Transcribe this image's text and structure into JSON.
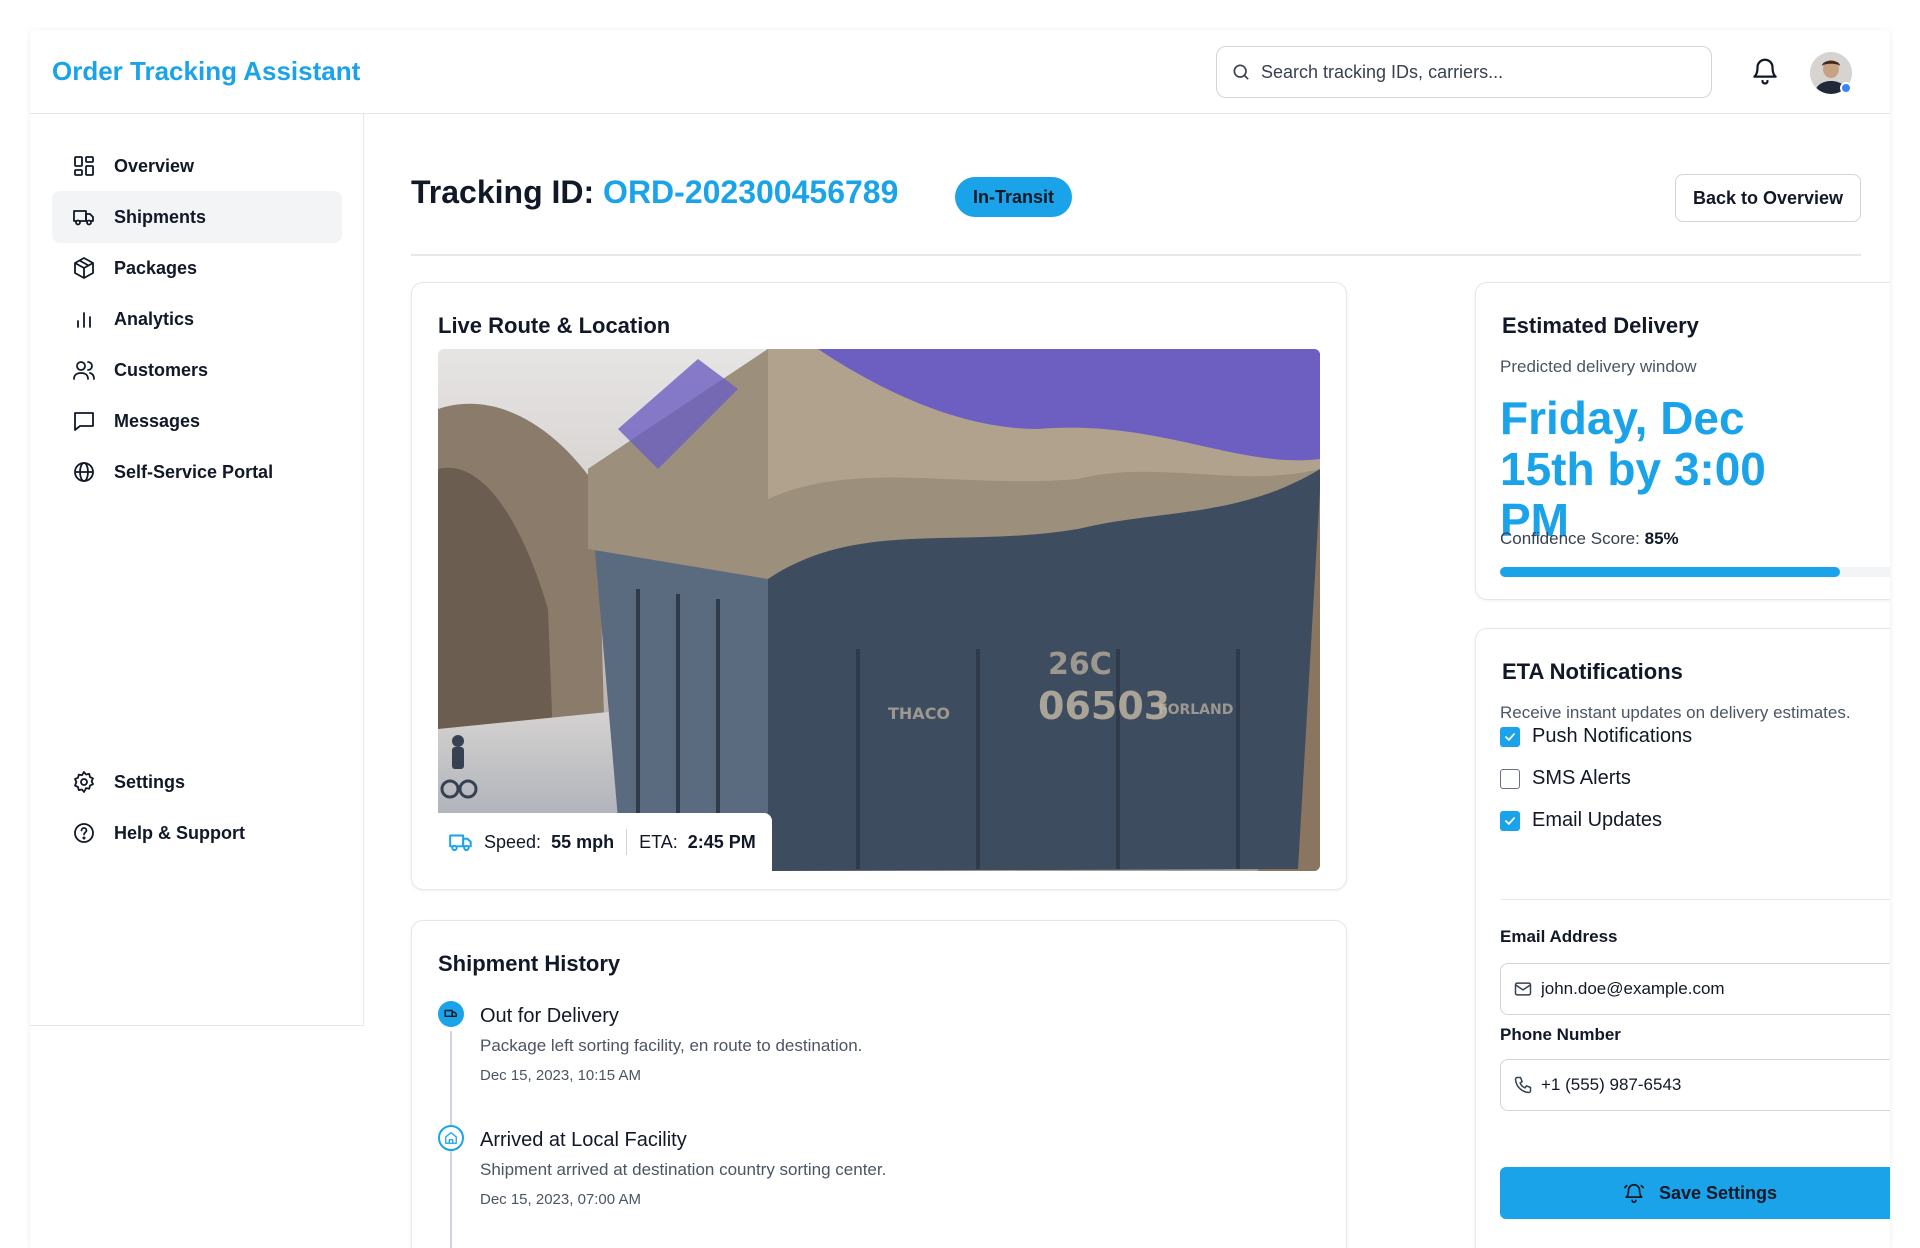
{
  "app": {
    "title": "Order Tracking Assistant"
  },
  "header": {
    "search_placeholder": "Search tracking IDs, carriers...",
    "icons": [
      "search-icon",
      "bell-icon",
      "avatar"
    ]
  },
  "sidebar": {
    "items": [
      {
        "label": "Overview",
        "icon": "grid-icon",
        "active": false
      },
      {
        "label": "Shipments",
        "icon": "truck-icon",
        "active": true
      },
      {
        "label": "Packages",
        "icon": "package-icon",
        "active": false
      },
      {
        "label": "Analytics",
        "icon": "bar-chart-icon",
        "active": false
      },
      {
        "label": "Customers",
        "icon": "users-icon",
        "active": false
      },
      {
        "label": "Messages",
        "icon": "message-icon",
        "active": false
      },
      {
        "label": "Self-Service Portal",
        "icon": "globe-icon",
        "active": false
      }
    ],
    "bottom_items": [
      {
        "label": "Settings",
        "icon": "gear-icon"
      },
      {
        "label": "Help & Support",
        "icon": "help-circle-icon"
      }
    ]
  },
  "page": {
    "heading_prefix": "Tracking ID: ",
    "tracking_id": "ORD-202300456789",
    "status_badge": "In-Transit",
    "back_button": "Back to Overview"
  },
  "route": {
    "title": "Live Route & Location",
    "speed_label": "Speed:",
    "speed_value": "55 mph",
    "eta_label": "ETA:",
    "eta_value": "2:45 PM"
  },
  "history": {
    "title": "Shipment History",
    "events": [
      {
        "title": "Out for Delivery",
        "description": "Package left sorting facility, en route to destination.",
        "time": "Dec 15, 2023, 10:15 AM",
        "icon": "truck-icon"
      },
      {
        "title": "Arrived at Local Facility",
        "description": "Shipment arrived at destination country sorting center.",
        "time": "Dec 15, 2023, 07:00 AM",
        "icon": "building-icon"
      }
    ]
  },
  "estimate": {
    "title": "Estimated Delivery",
    "subtitle": "Predicted delivery window",
    "value": "Friday, Dec 15th by 3:00 PM",
    "confidence_label": "Confidence Score:",
    "confidence_value": "85%",
    "confidence_fraction": 0.85
  },
  "notifications": {
    "title": "ETA Notifications",
    "subtitle": "Receive instant updates on delivery estimates.",
    "options": [
      {
        "label": "Push Notifications",
        "checked": true
      },
      {
        "label": "SMS Alerts",
        "checked": false
      },
      {
        "label": "Email Updates",
        "checked": true
      }
    ],
    "email_label": "Email Address",
    "email_value": "john.doe@example.com",
    "phone_label": "Phone Number",
    "phone_value": "+1 (555) 987-6543",
    "save_button": "Save Settings"
  },
  "colors": {
    "accent": "#1aa3e8",
    "border": "#e5e7eb",
    "text": "#111827",
    "muted": "#4b5563"
  }
}
